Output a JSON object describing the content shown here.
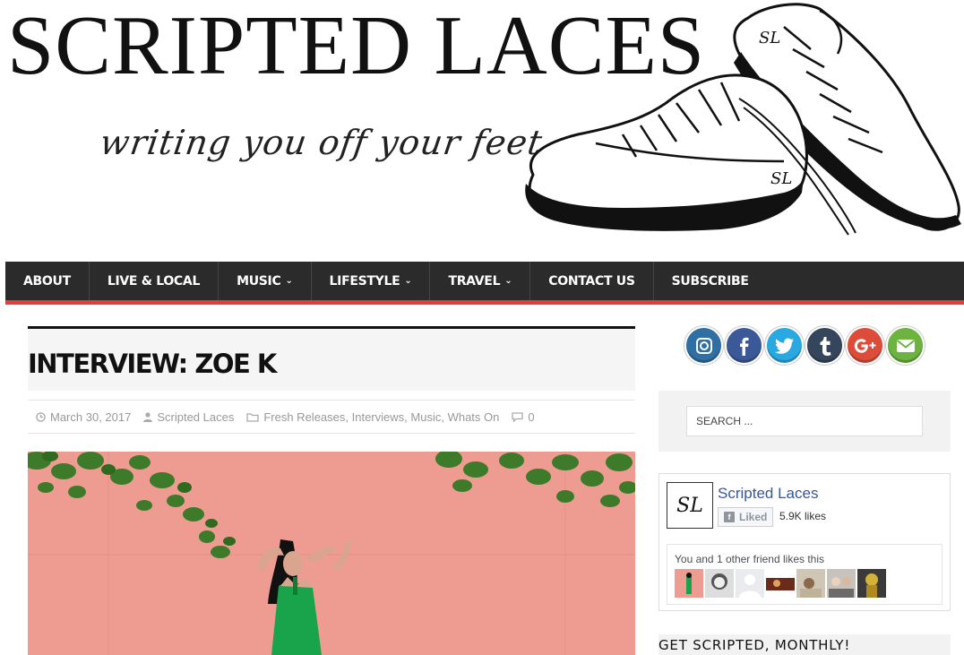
{
  "site": {
    "title": "SCRIPTED LACES",
    "tagline": "writing you off your feet"
  },
  "nav": {
    "items": [
      {
        "label": "ABOUT",
        "dropdown": false
      },
      {
        "label": "LIVE & LOCAL",
        "dropdown": false
      },
      {
        "label": "MUSIC",
        "dropdown": true
      },
      {
        "label": "LIFESTYLE",
        "dropdown": true
      },
      {
        "label": "TRAVEL",
        "dropdown": true
      },
      {
        "label": "CONTACT US",
        "dropdown": false
      },
      {
        "label": "SUBSCRIBE",
        "dropdown": false
      }
    ],
    "chevron": "⌄"
  },
  "post": {
    "title": "INTERVIEW: ZOE K",
    "date": "March 30, 2017",
    "author": "Scripted Laces",
    "categories": [
      "Fresh Releases",
      "Interviews",
      "Music",
      "Whats On"
    ],
    "comments": "0"
  },
  "sidebar": {
    "social": [
      {
        "name": "instagram",
        "color": "#2f6fa3"
      },
      {
        "name": "facebook",
        "color": "#3b5998"
      },
      {
        "name": "twitter",
        "color": "#29a9e1"
      },
      {
        "name": "tumblr",
        "color": "#35465c"
      },
      {
        "name": "google-plus",
        "color": "#dd4b39"
      },
      {
        "name": "email",
        "color": "#6cb33f"
      }
    ],
    "search_placeholder": "SEARCH ...",
    "facebook": {
      "page_name": "Scripted Laces",
      "liked_label": "Liked",
      "likes": "5.9K likes",
      "friends_text": "You and 1 other friend likes this",
      "logo_text": "SL"
    },
    "newsletter_title": "GET SCRIPTED, MONTHLY!"
  },
  "colors": {
    "nav_bg": "#2b2b2b",
    "nav_accent": "#e0403a",
    "link": "#365899",
    "feature_wall": "#ee9c92"
  }
}
